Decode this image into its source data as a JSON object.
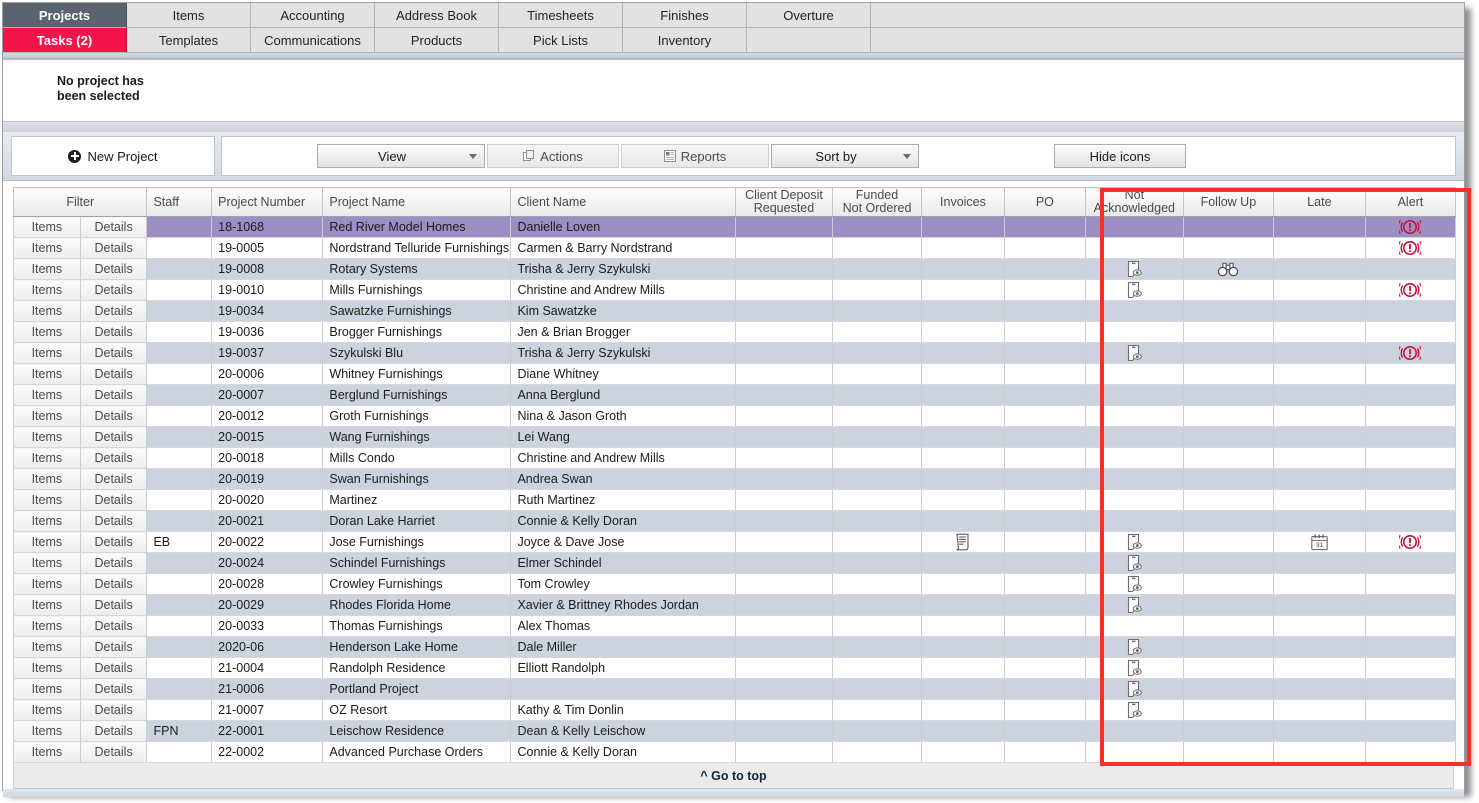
{
  "tabs": {
    "row1": [
      {
        "label": "Projects",
        "state": "active-dark"
      },
      {
        "label": "Items",
        "state": "normal"
      },
      {
        "label": "Accounting",
        "state": "normal"
      },
      {
        "label": "Address Book",
        "state": "normal"
      },
      {
        "label": "Timesheets",
        "state": "normal"
      },
      {
        "label": "Finishes",
        "state": "normal"
      },
      {
        "label": "Overture",
        "state": "normal"
      }
    ],
    "row2": [
      {
        "label": "Tasks (2)",
        "state": "active-red"
      },
      {
        "label": "Templates",
        "state": "normal"
      },
      {
        "label": "Communications",
        "state": "normal"
      },
      {
        "label": "Products",
        "state": "normal"
      },
      {
        "label": "Pick Lists",
        "state": "normal"
      },
      {
        "label": "Inventory",
        "state": "normal"
      },
      {
        "label": "",
        "state": "blank"
      }
    ]
  },
  "status": {
    "message": "No project has\nbeen selected"
  },
  "toolbar": {
    "new_project": "New Project",
    "view": "View",
    "actions": "Actions",
    "reports": "Reports",
    "sort_by": "Sort by",
    "hide_icons": "Hide icons"
  },
  "grid": {
    "filter_header": "Filter",
    "row_buttons": {
      "items": "Items",
      "details": "Details"
    },
    "columns": [
      {
        "key": "items",
        "label": "",
        "align": "center"
      },
      {
        "key": "details",
        "label": "",
        "align": "center"
      },
      {
        "key": "staff",
        "label": "Staff",
        "align": "left"
      },
      {
        "key": "project_number",
        "label": "Project Number",
        "align": "left"
      },
      {
        "key": "project_name",
        "label": "Project Name",
        "align": "left"
      },
      {
        "key": "client_name",
        "label": "Client Name",
        "align": "left"
      },
      {
        "key": "client_deposit_requested",
        "label": "Client Deposit\nRequested",
        "align": "center"
      },
      {
        "key": "funded_not_ordered",
        "label": "Funded\nNot Ordered",
        "align": "center"
      },
      {
        "key": "invoices",
        "label": "Invoices",
        "align": "center"
      },
      {
        "key": "po",
        "label": "PO",
        "align": "center"
      },
      {
        "key": "not_acknowledged",
        "label": "Not\nAcknowledged",
        "align": "center"
      },
      {
        "key": "follow_up",
        "label": "Follow Up",
        "align": "center"
      },
      {
        "key": "late",
        "label": "Late",
        "align": "center"
      },
      {
        "key": "alert",
        "label": "Alert",
        "align": "center"
      }
    ],
    "rows": [
      {
        "staff": "",
        "project_number": "18-1068",
        "project_name": "Red River Model Homes",
        "client_name": "Danielle Loven",
        "client_deposit_requested": "",
        "funded_not_ordered": "",
        "invoices": "",
        "po": "",
        "not_acknowledged": "",
        "follow_up": "",
        "late": "",
        "alert": "alert-icon",
        "selected": true
      },
      {
        "staff": "",
        "project_number": "19-0005",
        "project_name": "Nordstrand Telluride Furnishings",
        "client_name": "Carmen & Barry Nordstrand",
        "client_deposit_requested": "",
        "funded_not_ordered": "",
        "invoices": "",
        "po": "",
        "not_acknowledged": "",
        "follow_up": "",
        "late": "",
        "alert": "alert-icon",
        "selected": false
      },
      {
        "staff": "",
        "project_number": "19-0008",
        "project_name": "Rotary Systems",
        "client_name": "Trisha & Jerry Szykulski",
        "client_deposit_requested": "",
        "funded_not_ordered": "",
        "invoices": "",
        "po": "",
        "not_acknowledged": "not-acknowledged-icon",
        "follow_up": "binoculars-icon",
        "late": "",
        "alert": "",
        "selected": false
      },
      {
        "staff": "",
        "project_number": "19-0010",
        "project_name": "Mills Furnishings",
        "client_name": "Christine and Andrew Mills",
        "client_deposit_requested": "",
        "funded_not_ordered": "",
        "invoices": "",
        "po": "",
        "not_acknowledged": "not-acknowledged-icon",
        "follow_up": "",
        "late": "",
        "alert": "alert-icon",
        "selected": false
      },
      {
        "staff": "",
        "project_number": "19-0034",
        "project_name": "Sawatzke Furnishings",
        "client_name": "Kim Sawatzke",
        "client_deposit_requested": "",
        "funded_not_ordered": "",
        "invoices": "",
        "po": "",
        "not_acknowledged": "",
        "follow_up": "",
        "late": "",
        "alert": "",
        "selected": false
      },
      {
        "staff": "",
        "project_number": "19-0036",
        "project_name": "Brogger Furnishings",
        "client_name": "Jen & Brian Brogger",
        "client_deposit_requested": "",
        "funded_not_ordered": "",
        "invoices": "",
        "po": "",
        "not_acknowledged": "",
        "follow_up": "",
        "late": "",
        "alert": "",
        "selected": false
      },
      {
        "staff": "",
        "project_number": "19-0037",
        "project_name": "Szykulski Blu",
        "client_name": "Trisha & Jerry Szykulski",
        "client_deposit_requested": "",
        "funded_not_ordered": "",
        "invoices": "",
        "po": "",
        "not_acknowledged": "not-acknowledged-icon",
        "follow_up": "",
        "late": "",
        "alert": "alert-icon",
        "selected": false
      },
      {
        "staff": "",
        "project_number": "20-0006",
        "project_name": "Whitney Furnishings",
        "client_name": "Diane Whitney",
        "client_deposit_requested": "",
        "funded_not_ordered": "",
        "invoices": "",
        "po": "",
        "not_acknowledged": "",
        "follow_up": "",
        "late": "",
        "alert": "",
        "selected": false
      },
      {
        "staff": "",
        "project_number": "20-0007",
        "project_name": "Berglund Furnishings",
        "client_name": "Anna Berglund",
        "client_deposit_requested": "",
        "funded_not_ordered": "",
        "invoices": "",
        "po": "",
        "not_acknowledged": "",
        "follow_up": "",
        "late": "",
        "alert": "",
        "selected": false
      },
      {
        "staff": "",
        "project_number": "20-0012",
        "project_name": "Groth Furnishings",
        "client_name": "Nina & Jason Groth",
        "client_deposit_requested": "",
        "funded_not_ordered": "",
        "invoices": "",
        "po": "",
        "not_acknowledged": "",
        "follow_up": "",
        "late": "",
        "alert": "",
        "selected": false
      },
      {
        "staff": "",
        "project_number": "20-0015",
        "project_name": "Wang Furnishings",
        "client_name": "Lei Wang",
        "client_deposit_requested": "",
        "funded_not_ordered": "",
        "invoices": "",
        "po": "",
        "not_acknowledged": "",
        "follow_up": "",
        "late": "",
        "alert": "",
        "selected": false
      },
      {
        "staff": "",
        "project_number": "20-0018",
        "project_name": "Mills Condo",
        "client_name": "Christine and Andrew Mills",
        "client_deposit_requested": "",
        "funded_not_ordered": "",
        "invoices": "",
        "po": "",
        "not_acknowledged": "",
        "follow_up": "",
        "late": "",
        "alert": "",
        "selected": false
      },
      {
        "staff": "",
        "project_number": "20-0019",
        "project_name": "Swan Furnishings",
        "client_name": "Andrea Swan",
        "client_deposit_requested": "",
        "funded_not_ordered": "",
        "invoices": "",
        "po": "",
        "not_acknowledged": "",
        "follow_up": "",
        "late": "",
        "alert": "",
        "selected": false
      },
      {
        "staff": "",
        "project_number": "20-0020",
        "project_name": "Martinez",
        "client_name": "Ruth Martinez",
        "client_deposit_requested": "",
        "funded_not_ordered": "",
        "invoices": "",
        "po": "",
        "not_acknowledged": "",
        "follow_up": "",
        "late": "",
        "alert": "",
        "selected": false
      },
      {
        "staff": "",
        "project_number": "20-0021",
        "project_name": "Doran Lake Harriet",
        "client_name": "Connie & Kelly Doran",
        "client_deposit_requested": "",
        "funded_not_ordered": "",
        "invoices": "",
        "po": "",
        "not_acknowledged": "",
        "follow_up": "",
        "late": "",
        "alert": "",
        "selected": false
      },
      {
        "staff": "EB",
        "project_number": "20-0022",
        "project_name": "Jose Furnishings",
        "client_name": "Joyce & Dave Jose",
        "client_deposit_requested": "",
        "funded_not_ordered": "",
        "invoices": "invoice-icon",
        "po": "",
        "not_acknowledged": "not-acknowledged-icon",
        "follow_up": "",
        "late": "calendar-icon",
        "alert": "alert-icon",
        "selected": false
      },
      {
        "staff": "",
        "project_number": "20-0024",
        "project_name": "Schindel Furnishings",
        "client_name": "Elmer Schindel",
        "client_deposit_requested": "",
        "funded_not_ordered": "",
        "invoices": "",
        "po": "",
        "not_acknowledged": "not-acknowledged-icon",
        "follow_up": "",
        "late": "",
        "alert": "",
        "selected": false
      },
      {
        "staff": "",
        "project_number": "20-0028",
        "project_name": "Crowley Furnishings",
        "client_name": "Tom Crowley",
        "client_deposit_requested": "",
        "funded_not_ordered": "",
        "invoices": "",
        "po": "",
        "not_acknowledged": "not-acknowledged-icon",
        "follow_up": "",
        "late": "",
        "alert": "",
        "selected": false
      },
      {
        "staff": "",
        "project_number": "20-0029",
        "project_name": "Rhodes Florida Home",
        "client_name": "Xavier & Brittney Rhodes Jordan",
        "client_deposit_requested": "",
        "funded_not_ordered": "",
        "invoices": "",
        "po": "",
        "not_acknowledged": "not-acknowledged-icon",
        "follow_up": "",
        "late": "",
        "alert": "",
        "selected": false
      },
      {
        "staff": "",
        "project_number": "20-0033",
        "project_name": "Thomas Furnishings",
        "client_name": "Alex Thomas",
        "client_deposit_requested": "",
        "funded_not_ordered": "",
        "invoices": "",
        "po": "",
        "not_acknowledged": "",
        "follow_up": "",
        "late": "",
        "alert": "",
        "selected": false
      },
      {
        "staff": "",
        "project_number": "2020-06",
        "project_name": "Henderson Lake Home",
        "client_name": "Dale Miller",
        "client_deposit_requested": "",
        "funded_not_ordered": "",
        "invoices": "",
        "po": "",
        "not_acknowledged": "not-acknowledged-icon",
        "follow_up": "",
        "late": "",
        "alert": "",
        "selected": false
      },
      {
        "staff": "",
        "project_number": "21-0004",
        "project_name": "Randolph Residence",
        "client_name": "Elliott Randolph",
        "client_deposit_requested": "",
        "funded_not_ordered": "",
        "invoices": "",
        "po": "",
        "not_acknowledged": "not-acknowledged-icon",
        "follow_up": "",
        "late": "",
        "alert": "",
        "selected": false
      },
      {
        "staff": "",
        "project_number": "21-0006",
        "project_name": "Portland Project",
        "client_name": "",
        "client_deposit_requested": "",
        "funded_not_ordered": "",
        "invoices": "",
        "po": "",
        "not_acknowledged": "not-acknowledged-icon",
        "follow_up": "",
        "late": "",
        "alert": "",
        "selected": false
      },
      {
        "staff": "",
        "project_number": "21-0007",
        "project_name": "OZ Resort",
        "client_name": "Kathy & Tim Donlin",
        "client_deposit_requested": "",
        "funded_not_ordered": "",
        "invoices": "",
        "po": "",
        "not_acknowledged": "not-acknowledged-icon",
        "follow_up": "",
        "late": "",
        "alert": "",
        "selected": false
      },
      {
        "staff": "FPN",
        "project_number": "22-0001",
        "project_name": "Leischow Residence",
        "client_name": "Dean & Kelly Leischow",
        "client_deposit_requested": "",
        "funded_not_ordered": "",
        "invoices": "",
        "po": "",
        "not_acknowledged": "",
        "follow_up": "",
        "late": "",
        "alert": "",
        "selected": false
      },
      {
        "staff": "",
        "project_number": "22-0002",
        "project_name": "Advanced Purchase Orders",
        "client_name": "Connie & Kelly Doran",
        "client_deposit_requested": "",
        "funded_not_ordered": "",
        "invoices": "",
        "po": "",
        "not_acknowledged": "",
        "follow_up": "",
        "late": "",
        "alert": "",
        "selected": false
      }
    ]
  },
  "footer": {
    "go_to_top": "^ Go to top"
  },
  "colors": {
    "tab_active_dark": "#5a636e",
    "tab_active_red": "#f5134b",
    "selected_row": "#9d8ec4",
    "alt_row": "#ccd3df",
    "highlight_rect": "#f8302a",
    "alert_icon": "#c8103c"
  }
}
